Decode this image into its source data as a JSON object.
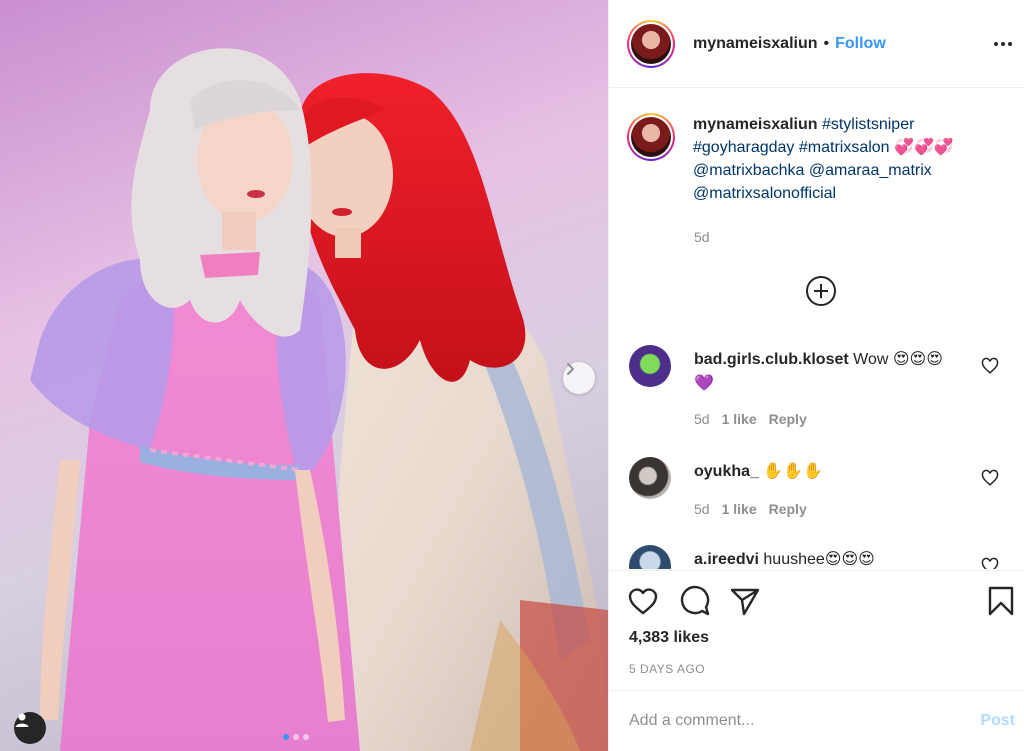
{
  "header": {
    "username": "mynameisxaliun",
    "separator": "•",
    "follow_label": "Follow"
  },
  "caption": {
    "username": "mynameisxaliun",
    "hashtags": [
      "#stylistsniper",
      "#goyharagday",
      "#matrixsalon"
    ],
    "emoji": "💞💞💞",
    "mentions": [
      "@matrixbachka",
      "@amaraa_matrix",
      "@matrixsalonofficial"
    ],
    "time": "5d"
  },
  "comments": [
    {
      "username": "bad.girls.club.kloset",
      "text": "Wow 😍😍😍",
      "text2": "💜",
      "time": "5d",
      "likes": "1 like",
      "reply": "Reply"
    },
    {
      "username": "oyukha_",
      "text": "✋✋✋",
      "time": "5d",
      "likes": "1 like",
      "reply": "Reply"
    },
    {
      "username": "a.ireedvi",
      "text": "huushee😍😍😍"
    }
  ],
  "stats": {
    "likes": "4,383 likes",
    "posted": "5 DAYS AGO"
  },
  "comment_box": {
    "placeholder": "Add a comment...",
    "post_label": "Post"
  },
  "carousel": {
    "slide_count": 3,
    "active_slide": 1
  },
  "colors": {
    "accent": "#3897f0",
    "muted": "#8e8e8e",
    "text": "#262626",
    "post_disabled": "#b3dbff"
  }
}
